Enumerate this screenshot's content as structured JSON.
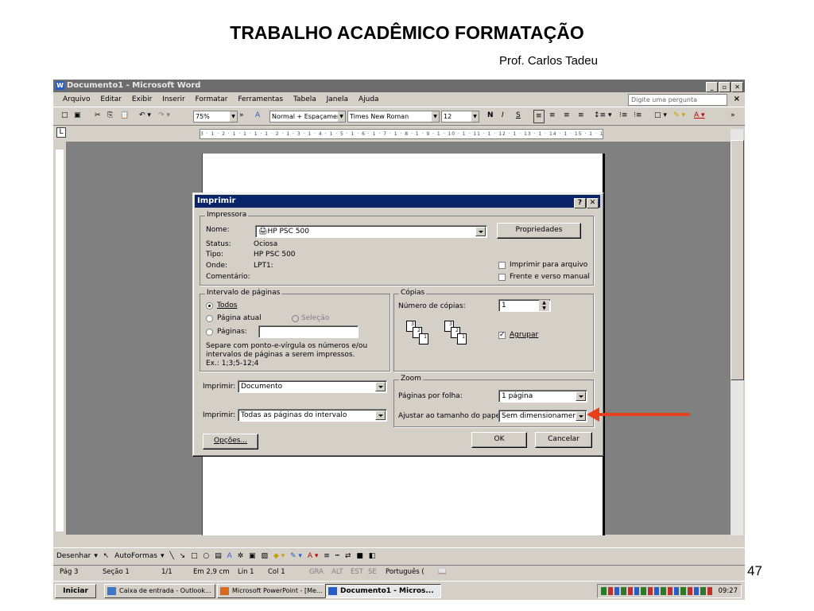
{
  "slide": {
    "title": "TRABALHO ACADÊMICO FORMATAÇÃO",
    "author": "Prof. Carlos Tadeu",
    "page_number": "47"
  },
  "window": {
    "title": "Documento1 - Microsoft Word",
    "icon": "word-icon"
  },
  "menu": {
    "items": [
      "Arquivo",
      "Editar",
      "Exibir",
      "Inserir",
      "Formatar",
      "Ferramentas",
      "Tabela",
      "Janela",
      "Ajuda"
    ],
    "ask_placeholder": "Digite uma pergunta"
  },
  "toolbar": {
    "zoom": "75%",
    "style": "Normal + Espaçamen",
    "font": "Times New Roman",
    "size": "12",
    "bold": "N",
    "italic": "I",
    "underline": "S"
  },
  "ruler": {
    "text": "3 · 1 · 2 · 1 · 1 · 1 · 1 · 2 · 1 · 3 · 1 · 4 · 1 · 5 · 1 · 6 · 1 · 7 · 1 · 8 · 1 · 9 · 1 · 10 · 1 · 11 · 1 · 12 · 1 · 13 · 1 · 14 · 1 · 15 · 1 · 17 ·"
  },
  "dialog": {
    "title": "Imprimir",
    "printer": {
      "group_label": "Impressora",
      "name_label": "Nome:",
      "name_value": "HP PSC 500",
      "properties_button": "Propriedades",
      "status_label": "Status:",
      "status_value": "Ociosa",
      "type_label": "Tipo:",
      "type_value": "HP PSC 500",
      "where_label": "Onde:",
      "where_value": "LPT1:",
      "comment_label": "Comentário:",
      "print_to_file": "Imprimir para arquivo",
      "manual_duplex": "Frente e verso manual"
    },
    "page_range": {
      "group_label": "Intervalo de páginas",
      "all": "Todos",
      "current_page": "Página atual",
      "selection": "Seleção",
      "pages": "Páginas:",
      "hint_line1": "Separe com ponto-e-vírgula os números e/ou",
      "hint_line2": "intervalos de páginas a serem impressos.",
      "hint_line3": "Ex.: 1;3;5-12;4"
    },
    "copies": {
      "group_label": "Cópias",
      "number_label": "Número de cópias:",
      "number_value": "1",
      "collate": "Agrupar"
    },
    "print_what": {
      "label": "Imprimir:",
      "value": "Documento"
    },
    "print_pages": {
      "label": "Imprimir:",
      "value": "Todas as páginas do intervalo"
    },
    "zoom": {
      "group_label": "Zoom",
      "pages_per_sheet_label": "Páginas por folha:",
      "pages_per_sheet_value": "1 página",
      "scale_label": "Ajustar ao tamanho do papel:",
      "scale_value": "Sem dimensionamento"
    },
    "options_button": "Opções...",
    "ok_button": "OK",
    "cancel_button": "Cancelar"
  },
  "draw_toolbar": {
    "draw": "Desenhar",
    "autoshapes": "AutoFormas"
  },
  "status": {
    "page": "Pág 3",
    "section": "Seção 1",
    "pages": "1/1",
    "position": "Em 2,9 cm",
    "line": "Lin 1",
    "column": "Col 1",
    "gra": "GRA",
    "alt": "ALT",
    "est": "EST",
    "se": "SE",
    "language": "Português ("
  },
  "taskbar": {
    "start": "Iniciar",
    "tasks": [
      "Caixa de entrada - Outlook...",
      "Microsoft PowerPoint - [Me...",
      "Documento1 - Micros..."
    ],
    "clock": "09:27"
  },
  "colors": {
    "annotation_arrow": "#e8401c",
    "dialog_title": "#0a246a"
  }
}
